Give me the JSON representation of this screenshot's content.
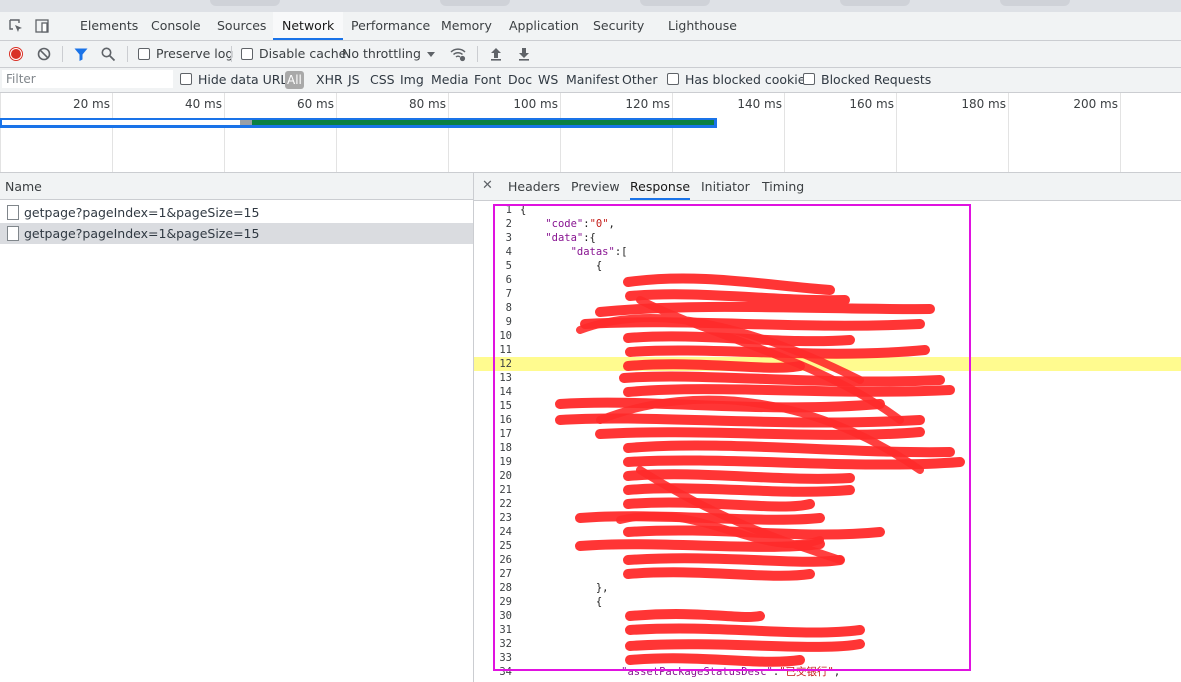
{
  "devtools_tabs": [
    "Elements",
    "Console",
    "Sources",
    "Network",
    "Performance",
    "Memory",
    "Application",
    "Security",
    "Lighthouse"
  ],
  "active_devtools_tab": "Network",
  "toolbar": {
    "preserve_log": "Preserve log",
    "disable_cache": "Disable cache",
    "throttling": "No throttling"
  },
  "filter_bar": {
    "placeholder": "Filter",
    "hide_data_urls": "Hide data URLs",
    "all": "All",
    "types": [
      "XHR",
      "JS",
      "CSS",
      "Img",
      "Media",
      "Font",
      "Doc",
      "WS",
      "Manifest",
      "Other"
    ],
    "has_blocked_cookies": "Has blocked cookies",
    "blocked_requests": "Blocked Requests"
  },
  "overview": {
    "ticks": [
      "20 ms",
      "40 ms",
      "60 ms",
      "80 ms",
      "100 ms",
      "120 ms",
      "140 ms",
      "160 ms",
      "180 ms",
      "200 ms"
    ]
  },
  "request_list": {
    "header": "Name",
    "rows": [
      "getpage?pageIndex=1&pageSize=15",
      "getpage?pageIndex=1&pageSize=15"
    ],
    "selected_index": 1
  },
  "detail": {
    "tabs": [
      "Headers",
      "Preview",
      "Response",
      "Initiator",
      "Timing"
    ],
    "active_tab": "Response",
    "highlighted_line": 12,
    "lines": [
      "{",
      "    \"code\":\"0\",",
      "    \"data\":{",
      "        \"datas\":[",
      "            {",
      "",
      "",
      "",
      "",
      "",
      "",
      "",
      "",
      "",
      "",
      "",
      "",
      "",
      "",
      "",
      "",
      "",
      "",
      "",
      "",
      "",
      "",
      "            },",
      "            {",
      "",
      "",
      "",
      "",
      "                \"assetPackageStatusDesc\":\"已交银行\","
    ]
  },
  "colors": {
    "accent": "#1a73e8",
    "annotation_box": "#e012e0",
    "redaction": "#ff2a2a",
    "line_highlight": "#fffb8f"
  }
}
